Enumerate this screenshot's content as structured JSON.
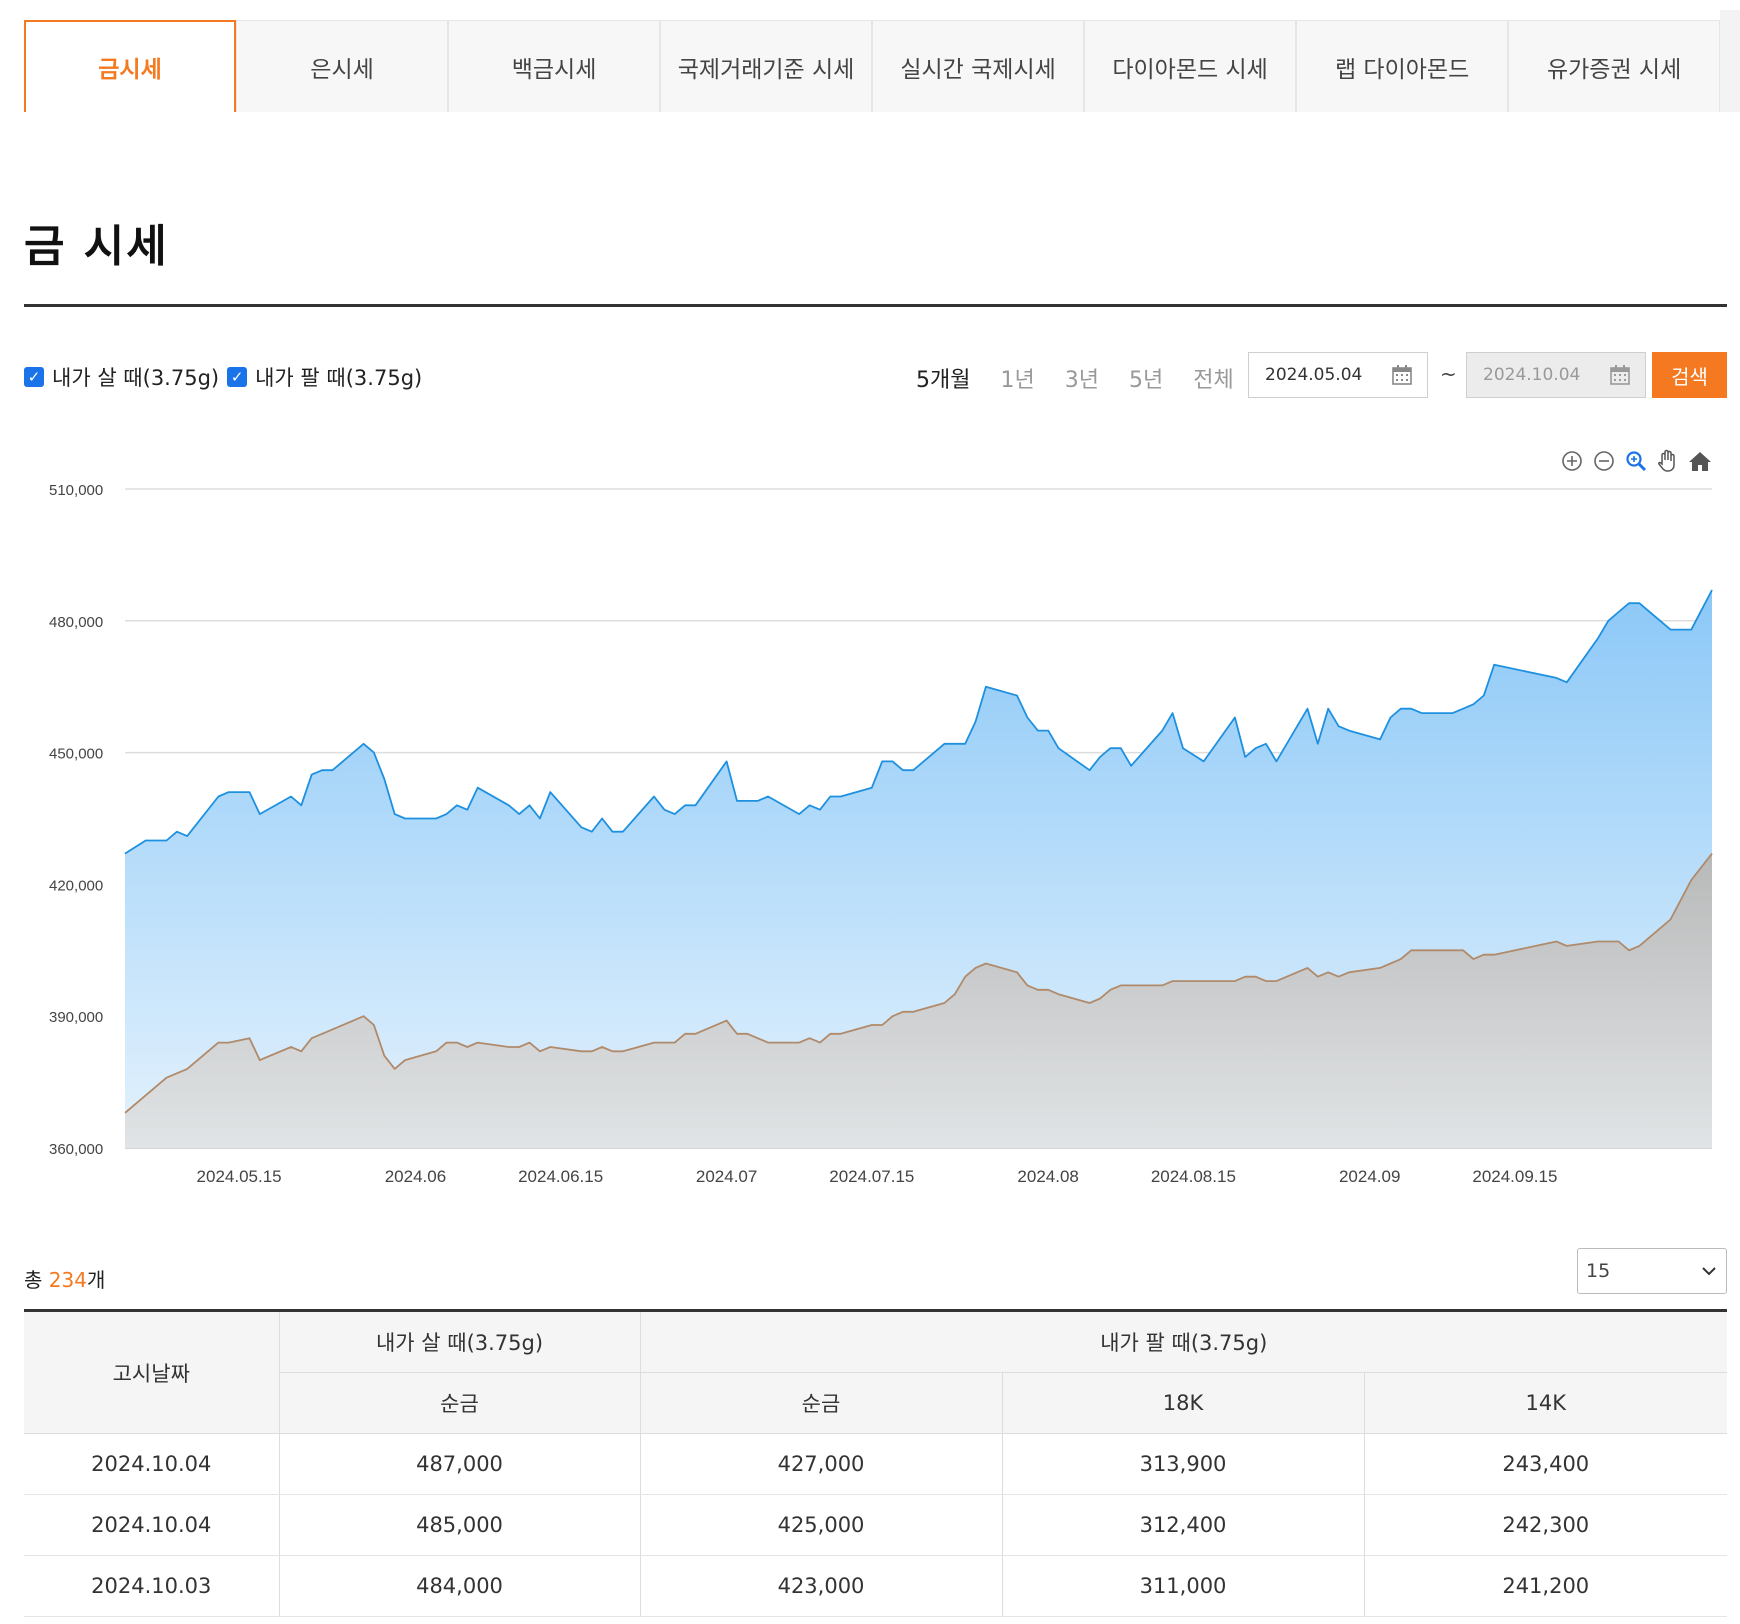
{
  "tabs": [
    {
      "label": "금시세",
      "active": true
    },
    {
      "label": "은시세",
      "active": false
    },
    {
      "label": "백금시세",
      "active": false
    },
    {
      "label": "국제거래기준 시세",
      "active": false
    },
    {
      "label": "실시간 국제시세",
      "active": false
    },
    {
      "label": "다이아몬드 시세",
      "active": false
    },
    {
      "label": "랩 다이아몬드",
      "active": false
    },
    {
      "label": "유가증권 시세",
      "active": false
    }
  ],
  "page_title": "금 시세",
  "filters": {
    "buy_label": "내가 살 때(3.75g)",
    "sell_label": "내가 팔 때(3.75g)",
    "periods": [
      "5개월",
      "1년",
      "3년",
      "5년",
      "전체"
    ],
    "start_date": "2024.05.04",
    "end_date": "2024.10.04",
    "tilde": "~",
    "search_label": "검색"
  },
  "colors": {
    "accent": "#f47920",
    "buy_line": "#1e90e0",
    "sell_line": "#b08a6a"
  },
  "chart_data": {
    "type": "area",
    "y_ticks": [
      "510,000",
      "480,000",
      "450,000",
      "420,000",
      "390,000",
      "360,000"
    ],
    "ylim": [
      360000,
      510000
    ],
    "x_ticks": [
      "2024.05.15",
      "2024.06",
      "2024.06.15",
      "2024.07",
      "2024.07.15",
      "2024.08",
      "2024.08.15",
      "2024.09",
      "2024.09.15"
    ],
    "x_tick_dates": [
      "2024-05-15",
      "2024-06-01",
      "2024-06-15",
      "2024-07-01",
      "2024-07-15",
      "2024-08-01",
      "2024-08-15",
      "2024-09-01",
      "2024-09-15"
    ],
    "series": [
      {
        "key": "buy",
        "dates": [
          "2024-05-04",
          "2024-05-06",
          "2024-05-08",
          "2024-05-09",
          "2024-05-10",
          "2024-05-13",
          "2024-05-14",
          "2024-05-16",
          "2024-05-17",
          "2024-05-20",
          "2024-05-21",
          "2024-05-22",
          "2024-05-23",
          "2024-05-24",
          "2024-05-27",
          "2024-05-28",
          "2024-05-29",
          "2024-05-30",
          "2024-05-31",
          "2024-06-03",
          "2024-06-04",
          "2024-06-05",
          "2024-06-06",
          "2024-06-07",
          "2024-06-10",
          "2024-06-11",
          "2024-06-12",
          "2024-06-13",
          "2024-06-14",
          "2024-06-17",
          "2024-06-18",
          "2024-06-19",
          "2024-06-20",
          "2024-06-21",
          "2024-06-24",
          "2024-06-25",
          "2024-06-26",
          "2024-06-27",
          "2024-06-28",
          "2024-07-01",
          "2024-07-02",
          "2024-07-03",
          "2024-07-04",
          "2024-07-05",
          "2024-07-08",
          "2024-07-09",
          "2024-07-10",
          "2024-07-11",
          "2024-07-12",
          "2024-07-15",
          "2024-07-16",
          "2024-07-17",
          "2024-07-18",
          "2024-07-19",
          "2024-07-22",
          "2024-07-23",
          "2024-07-24",
          "2024-07-25",
          "2024-07-26",
          "2024-07-29",
          "2024-07-30",
          "2024-07-31",
          "2024-08-01",
          "2024-08-02",
          "2024-08-05",
          "2024-08-06",
          "2024-08-07",
          "2024-08-08",
          "2024-08-09",
          "2024-08-12",
          "2024-08-13",
          "2024-08-14",
          "2024-08-16",
          "2024-08-19",
          "2024-08-20",
          "2024-08-21",
          "2024-08-22",
          "2024-08-23",
          "2024-08-26",
          "2024-08-27",
          "2024-08-28",
          "2024-08-29",
          "2024-08-30",
          "2024-09-02",
          "2024-09-03",
          "2024-09-04",
          "2024-09-05",
          "2024-09-06",
          "2024-09-09",
          "2024-09-10",
          "2024-09-11",
          "2024-09-12",
          "2024-09-13",
          "2024-09-19",
          "2024-09-20",
          "2024-09-23",
          "2024-09-24",
          "2024-09-25",
          "2024-09-26",
          "2024-09-27",
          "2024-09-30",
          "2024-10-02",
          "2024-10-04"
        ],
        "values": [
          427000,
          430000,
          430000,
          432000,
          431000,
          440000,
          441000,
          441000,
          436000,
          440000,
          438000,
          445000,
          446000,
          446000,
          452000,
          450000,
          444000,
          436000,
          435000,
          435000,
          436000,
          438000,
          437000,
          442000,
          438000,
          436000,
          438000,
          435000,
          441000,
          433000,
          432000,
          435000,
          432000,
          432000,
          440000,
          437000,
          436000,
          438000,
          438000,
          448000,
          439000,
          439000,
          439000,
          440000,
          436000,
          438000,
          437000,
          440000,
          440000,
          442000,
          448000,
          448000,
          446000,
          446000,
          452000,
          452000,
          452000,
          457000,
          465000,
          463000,
          458000,
          455000,
          455000,
          451000,
          446000,
          449000,
          451000,
          451000,
          447000,
          455000,
          459000,
          451000,
          448000,
          458000,
          449000,
          451000,
          452000,
          448000,
          460000,
          452000,
          460000,
          456000,
          455000,
          453000,
          458000,
          460000,
          460000,
          459000,
          459000,
          460000,
          461000,
          463000,
          470000,
          467000,
          466000,
          476000,
          480000,
          482000,
          484000,
          484000,
          478000,
          478000,
          487000
        ]
      },
      {
        "key": "sell",
        "dates": [
          "2024-05-04",
          "2024-05-06",
          "2024-05-08",
          "2024-05-09",
          "2024-05-10",
          "2024-05-13",
          "2024-05-14",
          "2024-05-16",
          "2024-05-17",
          "2024-05-20",
          "2024-05-21",
          "2024-05-22",
          "2024-05-23",
          "2024-05-24",
          "2024-05-27",
          "2024-05-28",
          "2024-05-29",
          "2024-05-30",
          "2024-05-31",
          "2024-06-03",
          "2024-06-04",
          "2024-06-05",
          "2024-06-06",
          "2024-06-07",
          "2024-06-10",
          "2024-06-11",
          "2024-06-12",
          "2024-06-13",
          "2024-06-14",
          "2024-06-17",
          "2024-06-18",
          "2024-06-19",
          "2024-06-20",
          "2024-06-21",
          "2024-06-24",
          "2024-06-25",
          "2024-06-26",
          "2024-06-27",
          "2024-06-28",
          "2024-07-01",
          "2024-07-02",
          "2024-07-03",
          "2024-07-04",
          "2024-07-05",
          "2024-07-08",
          "2024-07-09",
          "2024-07-10",
          "2024-07-11",
          "2024-07-12",
          "2024-07-15",
          "2024-07-16",
          "2024-07-17",
          "2024-07-18",
          "2024-07-19",
          "2024-07-22",
          "2024-07-23",
          "2024-07-24",
          "2024-07-25",
          "2024-07-26",
          "2024-07-29",
          "2024-07-30",
          "2024-07-31",
          "2024-08-01",
          "2024-08-02",
          "2024-08-05",
          "2024-08-06",
          "2024-08-07",
          "2024-08-08",
          "2024-08-09",
          "2024-08-12",
          "2024-08-13",
          "2024-08-14",
          "2024-08-16",
          "2024-08-19",
          "2024-08-20",
          "2024-08-21",
          "2024-08-22",
          "2024-08-23",
          "2024-08-26",
          "2024-08-27",
          "2024-08-28",
          "2024-08-29",
          "2024-08-30",
          "2024-09-02",
          "2024-09-03",
          "2024-09-04",
          "2024-09-05",
          "2024-09-06",
          "2024-09-09",
          "2024-09-10",
          "2024-09-11",
          "2024-09-12",
          "2024-09-13",
          "2024-09-19",
          "2024-09-20",
          "2024-09-23",
          "2024-09-24",
          "2024-09-25",
          "2024-09-26",
          "2024-09-27",
          "2024-09-30",
          "2024-10-02",
          "2024-10-04"
        ],
        "values": [
          368000,
          372000,
          376000,
          377000,
          378000,
          384000,
          384000,
          385000,
          380000,
          383000,
          382000,
          385000,
          386000,
          387000,
          390000,
          388000,
          381000,
          378000,
          380000,
          382000,
          384000,
          384000,
          383000,
          384000,
          383000,
          383000,
          384000,
          382000,
          383000,
          382000,
          382000,
          383000,
          382000,
          382000,
          384000,
          384000,
          384000,
          386000,
          386000,
          389000,
          386000,
          386000,
          385000,
          384000,
          384000,
          385000,
          384000,
          386000,
          386000,
          388000,
          388000,
          390000,
          391000,
          391000,
          393000,
          395000,
          399000,
          401000,
          402000,
          400000,
          397000,
          396000,
          396000,
          395000,
          393000,
          394000,
          396000,
          397000,
          397000,
          397000,
          398000,
          398000,
          398000,
          398000,
          399000,
          399000,
          398000,
          398000,
          401000,
          399000,
          400000,
          399000,
          400000,
          401000,
          402000,
          403000,
          405000,
          405000,
          405000,
          405000,
          403000,
          404000,
          404000,
          407000,
          406000,
          407000,
          407000,
          407000,
          405000,
          406000,
          412000,
          421000,
          427000
        ]
      }
    ]
  },
  "chart_tools": [
    "zoom-in-icon",
    "zoom-out-icon",
    "magnifier-icon",
    "pan-hand-icon",
    "home-icon"
  ],
  "list": {
    "count_prefix": "총 ",
    "count": "234",
    "count_suffix": "개",
    "page_size": "15"
  },
  "table": {
    "date_header": "고시날짜",
    "buy_header": "내가 살 때(3.75g)",
    "sell_header": "내가 팔 때(3.75g)",
    "sub_headers": [
      "순금",
      "순금",
      "18K",
      "14K"
    ],
    "rows": [
      [
        "2024.10.04",
        "487,000",
        "427,000",
        "313,900",
        "243,400"
      ],
      [
        "2024.10.04",
        "485,000",
        "425,000",
        "312,400",
        "242,300"
      ],
      [
        "2024.10.03",
        "484,000",
        "423,000",
        "311,000",
        "241,200"
      ]
    ]
  }
}
